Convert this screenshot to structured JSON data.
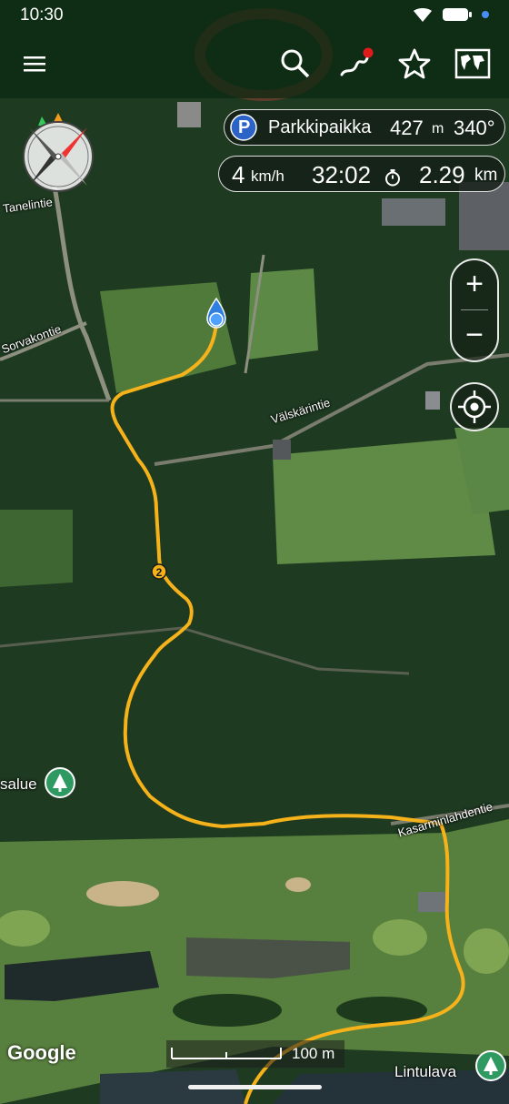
{
  "status_bar": {
    "time": "10:30"
  },
  "toolbar": {
    "menu_icon": "hamburger-menu-icon",
    "search_icon": "search-icon",
    "track_icon": "track-recording-icon",
    "favorites_icon": "star-icon",
    "maps_icon": "world-map-icon"
  },
  "target": {
    "icon": "parking-icon",
    "icon_letter": "P",
    "name": "Parkkipaikka",
    "distance": "427",
    "distance_unit": "m",
    "bearing": "340°"
  },
  "trip": {
    "speed": "4",
    "speed_unit": "km/h",
    "duration": "32:02",
    "duration_icon": "stopwatch-icon",
    "distance": "2.29",
    "distance_unit": "km"
  },
  "map_controls": {
    "zoom_in": "+",
    "zoom_out": "−",
    "locate_icon": "my-location-icon"
  },
  "road_labels": {
    "tanelintie": "Tanelintie",
    "sorvakontie": "Sorvakontie",
    "valskarintie": "Välskärintie",
    "kasarminlahdentie": "Kasarminlahdentie"
  },
  "poi_labels": {
    "alue": "salue",
    "lintulava": "Lintulava"
  },
  "waypoint_label": "2",
  "attribution": "Google",
  "scale": "100 m",
  "colors": {
    "track": "#f6b21b",
    "location": "#2f7fe0",
    "poi": "#2e9a62"
  }
}
